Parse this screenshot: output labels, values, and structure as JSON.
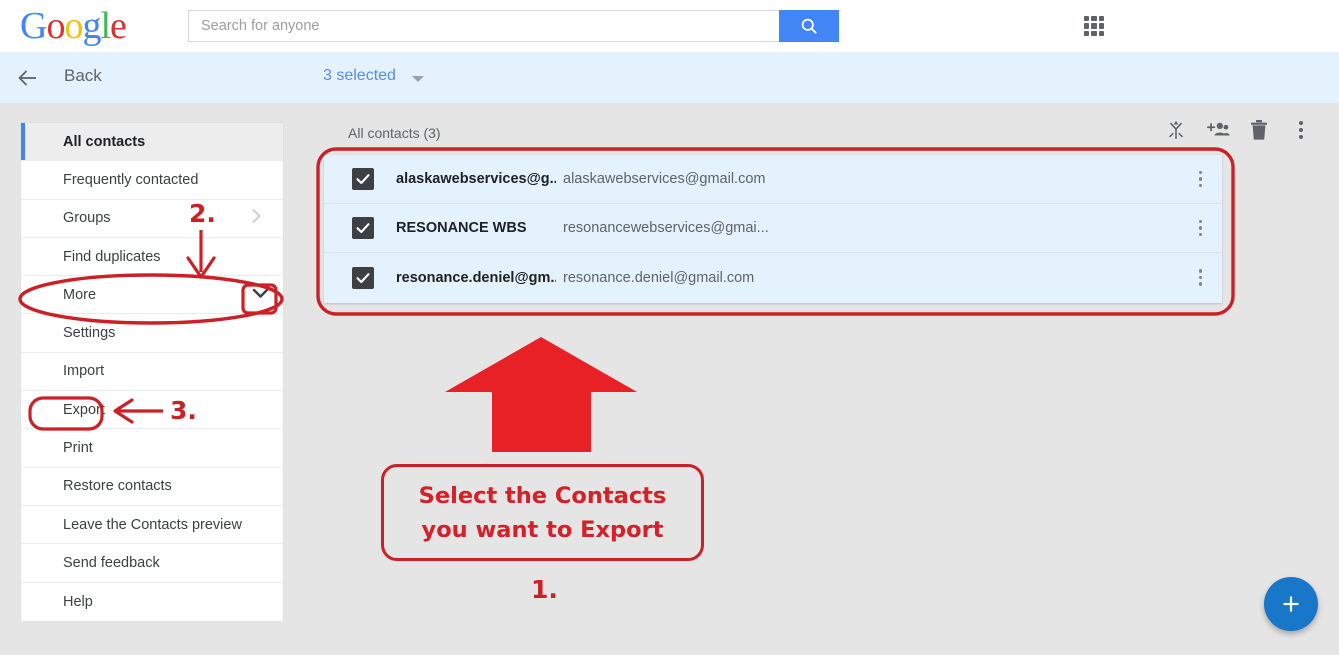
{
  "topbar": {
    "logo": [
      {
        "ch": "G",
        "cls": "gl-b"
      },
      {
        "ch": "o",
        "cls": "gl-r"
      },
      {
        "ch": "o",
        "cls": "gl-y"
      },
      {
        "ch": "g",
        "cls": "gl-b"
      },
      {
        "ch": "l",
        "cls": "gl-g"
      },
      {
        "ch": "e",
        "cls": "gl-r"
      }
    ],
    "logo_text": "Google",
    "search_placeholder": "Search for anyone",
    "search_value": "",
    "search_icon": "search-icon",
    "apps_icon": "apps-grid-icon"
  },
  "actionbar": {
    "back_label": "Back",
    "back_icon": "arrow-left-icon",
    "selected_label": "3 selected",
    "dropdown_icon": "caret-down-icon",
    "icons": [
      {
        "name": "merge-icon",
        "label": "Merge"
      },
      {
        "name": "add-to-group-icon",
        "label": "Add to group"
      },
      {
        "name": "delete-icon",
        "label": "Delete"
      },
      {
        "name": "more-options-icon",
        "label": "More options"
      }
    ]
  },
  "sidebar": {
    "items": [
      {
        "label": "All contacts",
        "active": true,
        "chevron": ""
      },
      {
        "label": "Frequently contacted",
        "active": false,
        "chevron": ""
      },
      {
        "label": "Groups",
        "active": false,
        "chevron": "right"
      },
      {
        "label": "Find duplicates",
        "active": false,
        "chevron": ""
      },
      {
        "label": "More",
        "active": false,
        "chevron": "down"
      },
      {
        "label": "Settings",
        "active": false,
        "chevron": ""
      },
      {
        "label": "Import",
        "active": false,
        "chevron": ""
      },
      {
        "label": "Export",
        "active": false,
        "chevron": ""
      },
      {
        "label": "Print",
        "active": false,
        "chevron": ""
      },
      {
        "label": "Restore contacts",
        "active": false,
        "chevron": ""
      },
      {
        "label": "Leave the Contacts preview",
        "active": false,
        "chevron": ""
      },
      {
        "label": "Send feedback",
        "active": false,
        "chevron": ""
      },
      {
        "label": "Help",
        "active": false,
        "chevron": ""
      }
    ]
  },
  "main": {
    "list_title": "All contacts (3)",
    "contacts": [
      {
        "checked": true,
        "name": "alaskawebservices@g...",
        "email": "alaskawebservices@gmail.com"
      },
      {
        "checked": true,
        "name": "RESONANCE WBS",
        "email": "resonancewebservices@gmai..."
      },
      {
        "checked": true,
        "name": "resonance.deniel@gm...",
        "email": "resonance.deniel@gmail.com"
      }
    ],
    "row_menu_icon": "row-more-options-icon",
    "fab_label": "+",
    "fab_icon": "add-contact-icon"
  },
  "annotations": {
    "color": "#cc2026",
    "arrow_color": "#e82127",
    "step1": "1.",
    "step2": "2.",
    "step3": "3.",
    "callout_line1": "Select the Contacts",
    "callout_line2": "you want to Export"
  }
}
